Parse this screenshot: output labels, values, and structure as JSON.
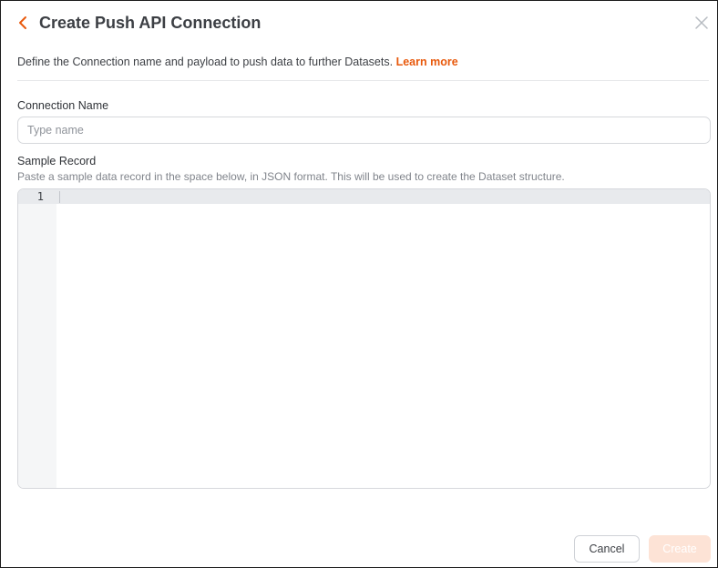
{
  "header": {
    "back_icon": "chevron-left-icon",
    "title": "Create Push API Connection",
    "close_icon": "close-icon"
  },
  "description": {
    "text": "Define the Connection name and payload to push data to further Datasets.",
    "link": "Learn more"
  },
  "connection_name": {
    "label": "Connection Name",
    "placeholder": "Type name",
    "value": ""
  },
  "sample_record": {
    "label": "Sample Record",
    "hint": "Paste a sample data record in the space below, in JSON format. This will be used to create the Dataset structure.",
    "line_numbers": [
      "1"
    ],
    "content": ""
  },
  "footer": {
    "cancel_label": "Cancel",
    "create_label": "Create"
  },
  "colors": {
    "accent": "#e8590c",
    "create_disabled_bg": "#fde3d6"
  }
}
